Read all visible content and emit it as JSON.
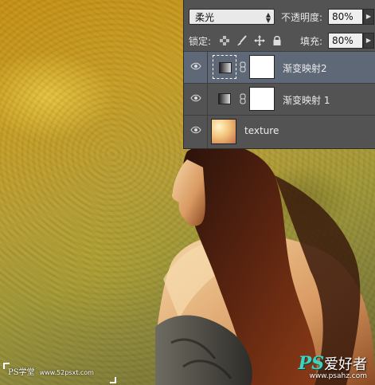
{
  "layers_panel": {
    "blend_mode": "柔光",
    "opacity_label": "不透明度:",
    "opacity_value": "80%",
    "lock_label": "锁定:",
    "fill_label": "填充:",
    "fill_value": "80%",
    "layers": [
      {
        "name": "渐变映射2",
        "type": "gradient-map",
        "selected": true,
        "visible": true
      },
      {
        "name": "渐变映射 1",
        "type": "gradient-map",
        "selected": false,
        "visible": true
      },
      {
        "name": "texture",
        "type": "image",
        "selected": false,
        "visible": true
      }
    ]
  },
  "watermark_left": {
    "brand": "PS学堂",
    "site": "www.52psxt.com"
  },
  "watermark_right": {
    "logo": "PS",
    "name": "爱好者",
    "url": "www.psahz.com"
  },
  "colors": {
    "panel_bg": "#535353",
    "selected_layer": "#5f6877",
    "background_yellow": "#c9a02a"
  }
}
